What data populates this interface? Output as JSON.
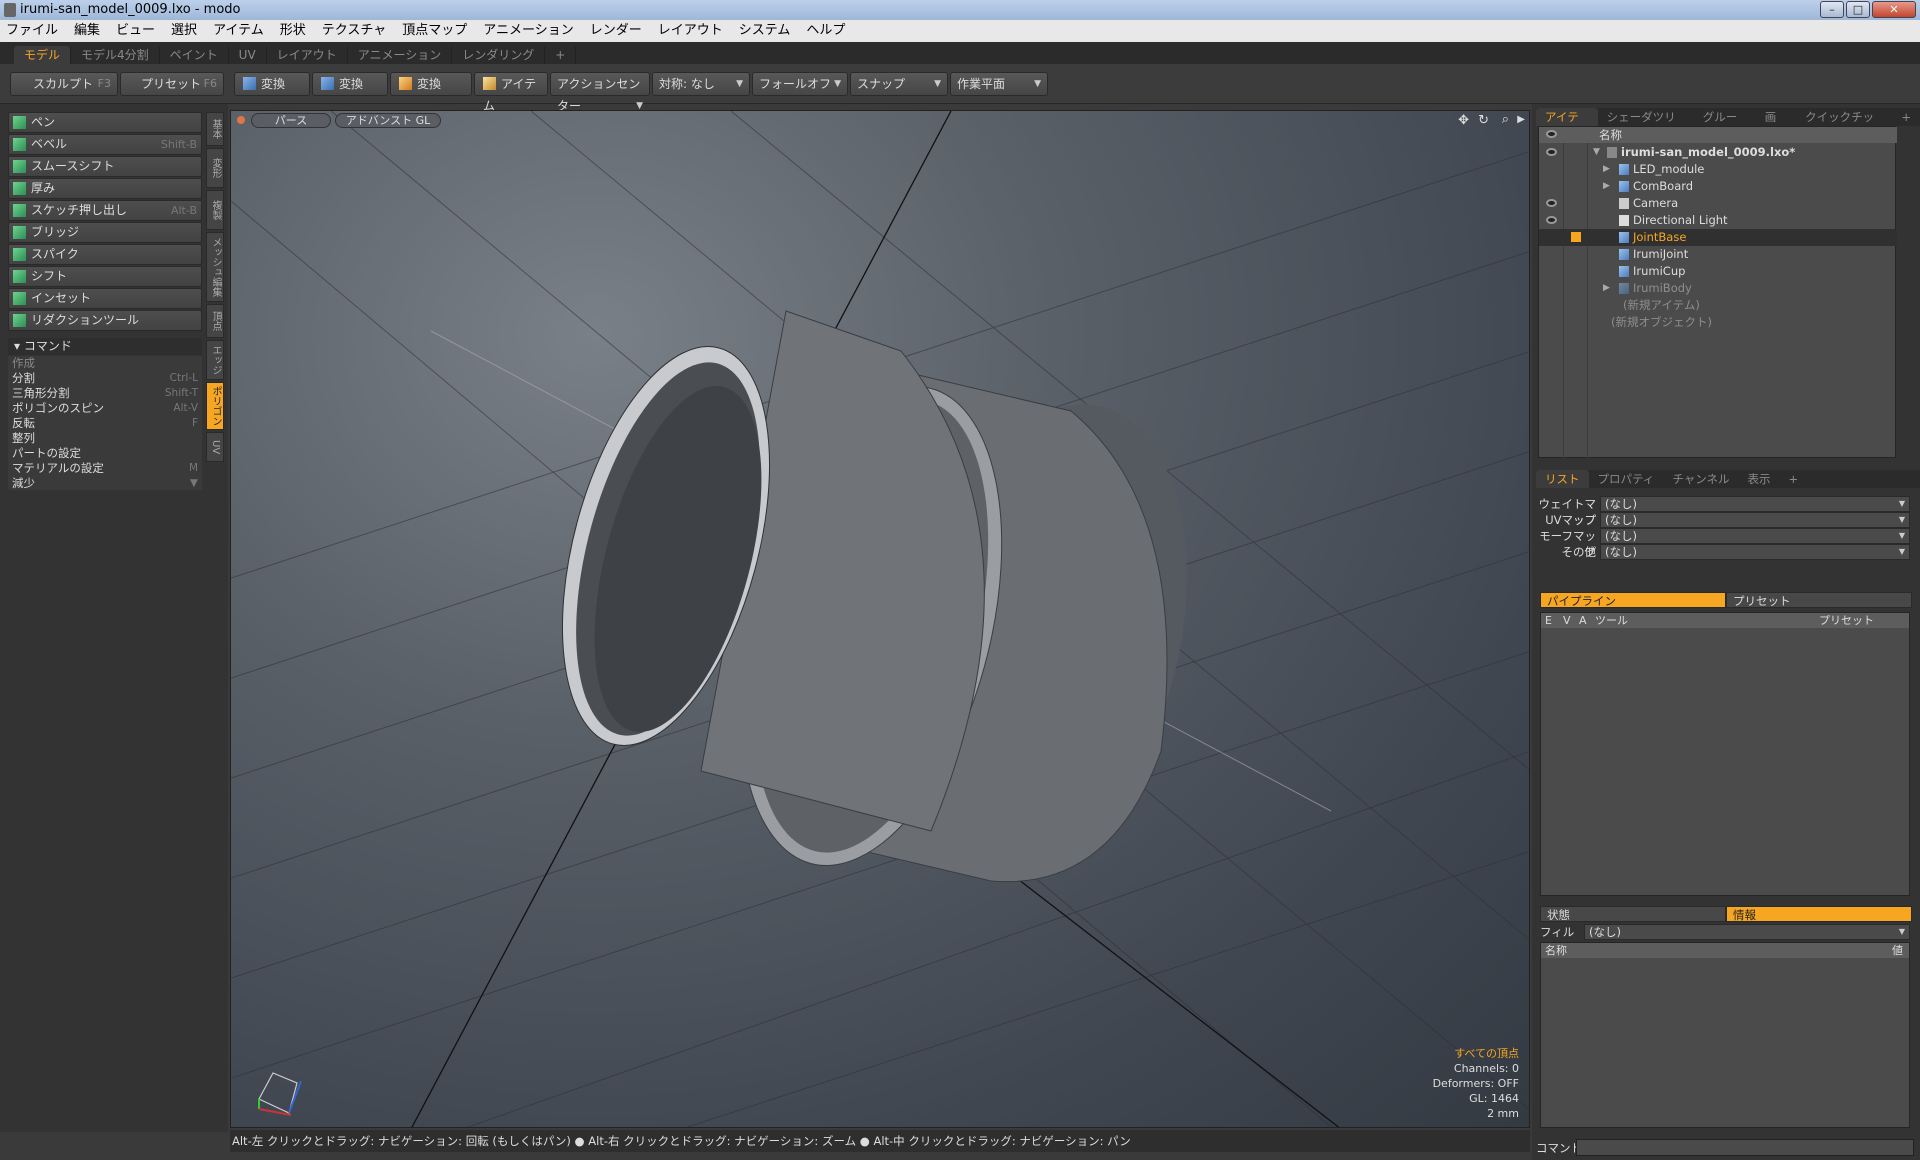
{
  "window": {
    "title": "irumi-san_model_0009.lxo - modo"
  },
  "menu": [
    "ファイル",
    "編集",
    "ビュー",
    "選択",
    "アイテム",
    "形状",
    "テクスチャ",
    "頂点マップ",
    "アニメーション",
    "レンダー",
    "レイアウト",
    "システム",
    "ヘルプ"
  ],
  "mode_tabs": [
    "モデル",
    "モデル4分割",
    "ペイント",
    "UV",
    "レイアウト",
    "アニメーション",
    "レンダリング",
    "+"
  ],
  "toolbar": {
    "sculpt": "スカルプト",
    "sculpt_key": "F3",
    "preset": "プリセット",
    "preset_key": "F6",
    "transform1": "変換",
    "transform2": "変換",
    "transform3": "変換",
    "item": "アイテム",
    "action_center": "アクションセンター",
    "symmetry": "対称: なし",
    "falloff": "フォールオフ",
    "snap": "スナップ",
    "workplane": "作業平面"
  },
  "tools": [
    {
      "label": "ペン",
      "key": ""
    },
    {
      "label": "ベベル",
      "key": "Shift-B"
    },
    {
      "label": "スムースシフト",
      "key": ""
    },
    {
      "label": "厚み",
      "key": ""
    },
    {
      "label": "スケッチ押し出し",
      "key": "Alt-B"
    },
    {
      "label": "ブリッジ",
      "key": ""
    },
    {
      "label": "スパイク",
      "key": ""
    },
    {
      "label": "シフト",
      "key": ""
    },
    {
      "label": "インセット",
      "key": ""
    },
    {
      "label": "リダクションツール",
      "key": ""
    }
  ],
  "commands": {
    "header": "コマンド",
    "items": [
      {
        "label": "作成",
        "key": "",
        "dim": true
      },
      {
        "label": "分割",
        "key": "Ctrl-L"
      },
      {
        "label": "三角形分割",
        "key": "Shift-T"
      },
      {
        "label": "ポリゴンのスピン",
        "key": "Alt-V"
      },
      {
        "label": "反転",
        "key": "F"
      },
      {
        "label": "整列",
        "key": ""
      },
      {
        "label": "パートの設定",
        "key": ""
      },
      {
        "label": "マテリアルの設定",
        "key": "M"
      },
      {
        "label": "減少",
        "key": ""
      }
    ]
  },
  "side_tabs": [
    "基本",
    "変形",
    "複製",
    "メッシュ編集",
    "頂点",
    "エッジ",
    "ポリゴン",
    "UV"
  ],
  "viewport": {
    "view_mode": "パース",
    "shading": "アドバンスト GL",
    "info_title": "すべての頂点",
    "channels": "Channels: 0",
    "deformers": "Deformers: OFF",
    "gl": "GL: 1464",
    "scale": "2 mm"
  },
  "status": "Alt-左 クリックとドラッグ: ナビゲーション: 回転 (もしくはパン) ● Alt-右 クリックとドラッグ: ナビゲーション: ズーム ● Alt-中 クリックとドラッグ: ナビゲーション: パン",
  "item_tabs": [
    "アイテム",
    "シェーダツリー",
    "グループ",
    "画像",
    "クイックチップ",
    "+"
  ],
  "scene_tree": {
    "col_name": "名称",
    "rows": [
      {
        "label": "irumi-san_model_0009.lxo*",
        "eye": true
      },
      {
        "label": "LED_module",
        "eye": false
      },
      {
        "label": "ComBoard",
        "eye": false
      },
      {
        "label": "Camera",
        "eye": true
      },
      {
        "label": "Directional Light",
        "eye": true
      },
      {
        "label": "JointBase",
        "eye": false
      },
      {
        "label": "IrumiJoint",
        "eye": false
      },
      {
        "label": "IrumiCup",
        "eye": false
      },
      {
        "label": "IrumiBody",
        "eye": false
      },
      {
        "label": "(新規アイテム)",
        "eye": false
      },
      {
        "label": "(新規オブジェクト)",
        "eye": false
      }
    ]
  },
  "list_tabs": [
    "リスト",
    "プロパティ",
    "チャンネル",
    "表示",
    "+"
  ],
  "maps": [
    {
      "label": "ウェイトマップ",
      "value": "(なし)"
    },
    {
      "label": "UVマップ",
      "value": "(なし)"
    },
    {
      "label": "モーフマップ",
      "value": "(なし)"
    },
    {
      "label": "その他",
      "value": "(なし)"
    }
  ],
  "pipeline": {
    "tab_pipeline": "パイプライン",
    "tab_preset": "プリセット",
    "cols": [
      "E",
      "V",
      "A",
      "ツール",
      "プリセット"
    ]
  },
  "info": {
    "tab_state": "状態",
    "tab_info": "情報",
    "filter_label": "フィルター",
    "filter_value": "(なし)",
    "col_name": "名称",
    "col_value": "値"
  },
  "command_label": "コマンド",
  "colors": {
    "accent": "#f7a622",
    "panel": "#333333",
    "viewport": "#4a5058"
  }
}
